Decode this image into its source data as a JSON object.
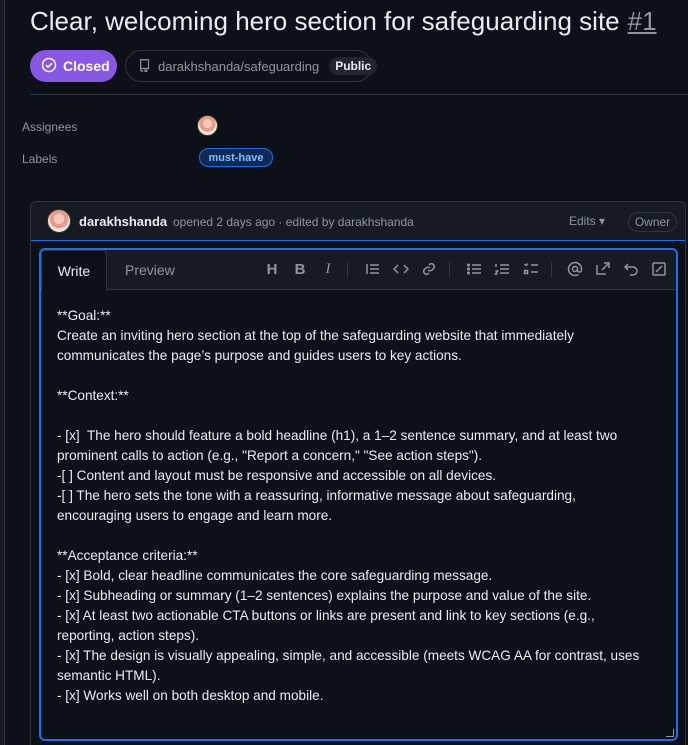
{
  "issue": {
    "title": "Clear, welcoming hero section for safeguarding site",
    "number": "#1",
    "status": "Closed",
    "repo": "darakhshanda/safeguarding",
    "visibility": "Public"
  },
  "sidebar": {
    "assignees_label": "Assignees",
    "labels_label": "Labels",
    "labels": [
      "must-have"
    ]
  },
  "comment": {
    "author": "darakhshanda",
    "meta": "opened 2 days ago · edited by darakhshanda",
    "edits_label": "Edits",
    "role_badge": "Owner"
  },
  "editor": {
    "tab_write": "Write",
    "tab_preview": "Preview",
    "toolbar_icons": [
      "heading-icon",
      "bold-icon",
      "italic-icon",
      "quote-icon",
      "code-icon",
      "link-icon",
      "unordered-list-icon",
      "ordered-list-icon",
      "task-list-icon",
      "mention-icon",
      "cross-reference-icon",
      "undo-icon",
      "fullscreen-icon"
    ],
    "lines": [
      "**Goal:**",
      "Create an inviting hero section at the top of the safeguarding website that immediately",
      "communicates the page’s purpose and guides users to key actions.",
      "",
      "**Context:**",
      "",
      "- [x]  The hero should feature a bold headline (h1), a 1–2 sentence summary, and at least two",
      "prominent calls to action (e.g., \"Report a concern,\" \"See action steps\").",
      "-[ ] Content and layout must be responsive and accessible on all devices.",
      "-[ ] The hero sets the tone with a reassuring, informative message about safeguarding,",
      "encouraging users to engage and learn more.",
      "",
      "**Acceptance criteria:**",
      "- [x] Bold, clear headline communicates the core safeguarding message.",
      "- [x] Subheading or summary (1–2 sentences) explains the purpose and value of the site.",
      "- [x] At least two actionable CTA buttons or links are present and link to key sections (e.g.,",
      "reporting, action steps).",
      "- [x] The design is visually appealing, simple, and accessible (meets WCAG AA for contrast, uses",
      "semantic HTML).",
      "- [x] Works well on both desktop and mobile."
    ]
  },
  "colors": {
    "closed_badge": "#8957e5",
    "accent": "#1f6feb",
    "background": "#0d1117"
  }
}
